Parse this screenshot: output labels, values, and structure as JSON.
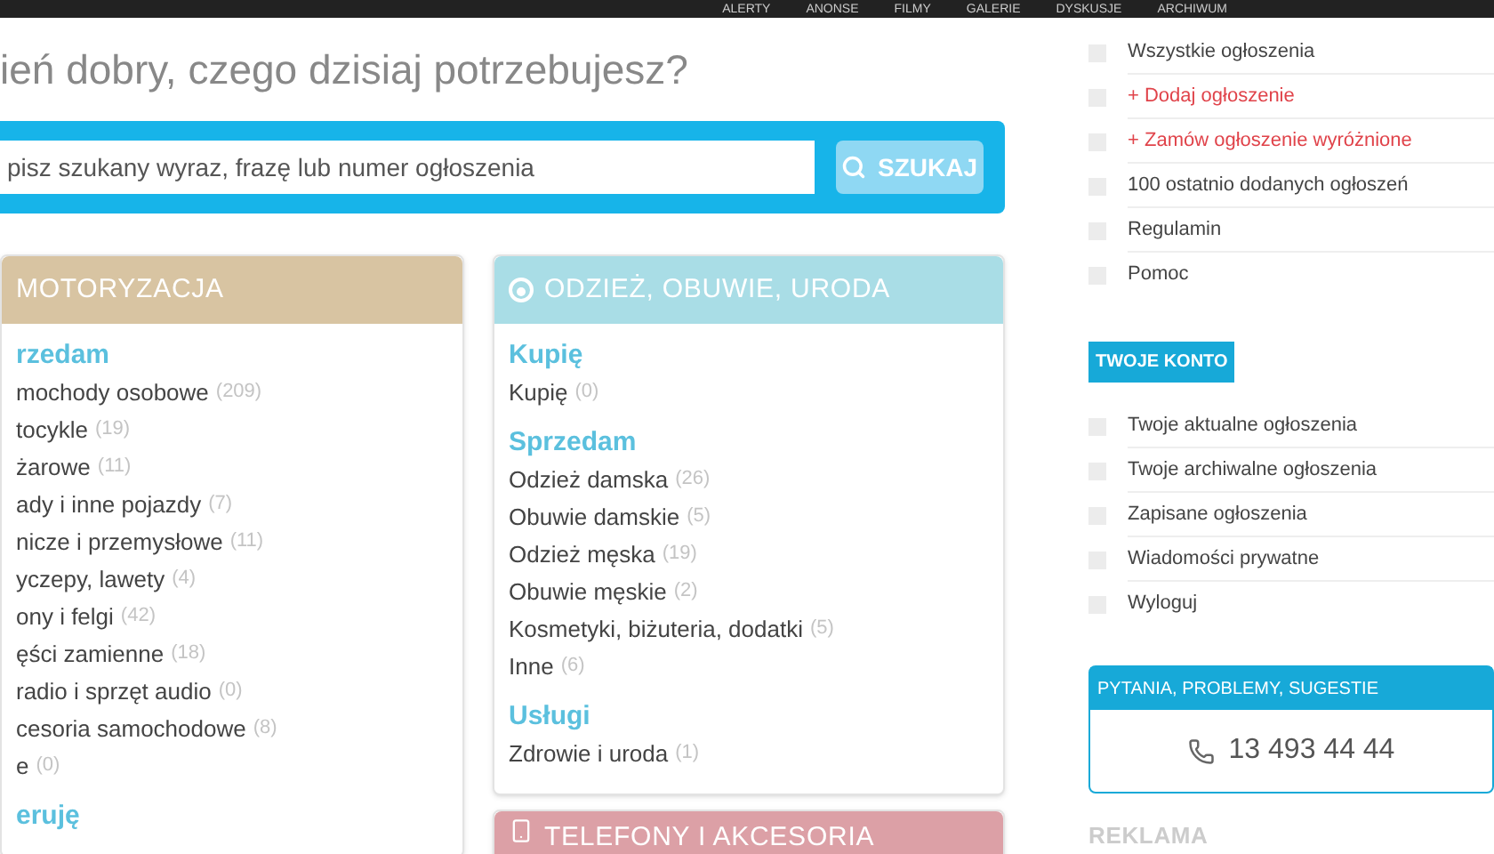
{
  "top_nav": [
    "ALERTY",
    "ANONSE",
    "FILMY",
    "GALERIE",
    "DYSKUSJE",
    "ARCHIWUM"
  ],
  "greeting": "ień dobry, czego dzisiaj potrzebujesz?",
  "search": {
    "placeholder": "pisz szukany wyraz, frazę lub numer ogłoszenia",
    "button": "SZUKAJ"
  },
  "categories": [
    {
      "title": "MOTORYZACJA",
      "color": "#d8c4a2",
      "sections": [
        {
          "heading": "rzedam",
          "items": [
            {
              "name": "mochody osobowe",
              "count": "(209)"
            },
            {
              "name": "tocykle",
              "count": "(19)"
            },
            {
              "name": "żarowe",
              "count": "(11)"
            },
            {
              "name": "ady i inne pojazdy",
              "count": "(7)"
            },
            {
              "name": "nicze i przemysłowe",
              "count": "(11)"
            },
            {
              "name": "yczepy, lawety",
              "count": "(4)"
            },
            {
              "name": "ony i felgi",
              "count": "(42)"
            },
            {
              "name": "ęści zamienne",
              "count": "(18)"
            },
            {
              "name": "radio i sprzęt audio",
              "count": "(0)"
            },
            {
              "name": "cesoria samochodowe",
              "count": "(8)"
            },
            {
              "name": "e",
              "count": "(0)"
            }
          ]
        },
        {
          "heading": "eruję"
        }
      ]
    },
    {
      "title": "ODZIEŻ, OBUWIE, URODA",
      "color": "#a9dde6",
      "sections": [
        {
          "heading": "Kupię",
          "items": [
            {
              "name": "Kupię",
              "count": "(0)"
            }
          ]
        },
        {
          "heading": "Sprzedam",
          "items": [
            {
              "name": "Odzież damska",
              "count": "(26)"
            },
            {
              "name": "Obuwie damskie",
              "count": "(5)"
            },
            {
              "name": "Odzież męska",
              "count": "(19)"
            },
            {
              "name": "Obuwie męskie",
              "count": "(2)"
            },
            {
              "name": "Kosmetyki, biżuteria, dodatki",
              "count": "(5)"
            },
            {
              "name": "Inne",
              "count": "(6)"
            }
          ]
        },
        {
          "heading": "Usługi",
          "items": [
            {
              "name": "Zdrowie i uroda",
              "count": "(1)"
            }
          ]
        }
      ]
    },
    {
      "title": "TELEFONY I AKCESORIA",
      "color": "#dca0a6"
    }
  ],
  "sidebar_links": [
    {
      "label": "Wszystkie ogłoszenia",
      "kind": "normal"
    },
    {
      "label": "+ Dodaj ogłoszenie",
      "kind": "promo"
    },
    {
      "label": "+ Zamów ogłoszenie wyróżnione",
      "kind": "promo"
    },
    {
      "label": "100 ostatnio dodanych ogłoszeń",
      "kind": "normal"
    },
    {
      "label": "Regulamin",
      "kind": "normal"
    },
    {
      "label": "Pomoc",
      "kind": "normal"
    }
  ],
  "account": {
    "title": "TWOJE KONTO",
    "links": [
      "Twoje aktualne ogłoszenia",
      "Twoje archiwalne ogłoszenia",
      "Zapisane ogłoszenia",
      "Wiadomości prywatne",
      "Wyloguj"
    ]
  },
  "contact": {
    "title": "PYTANIA, PROBLEMY, SUGESTIE",
    "phone": "13 493 44 44"
  },
  "ad_label": "REKLAMA"
}
